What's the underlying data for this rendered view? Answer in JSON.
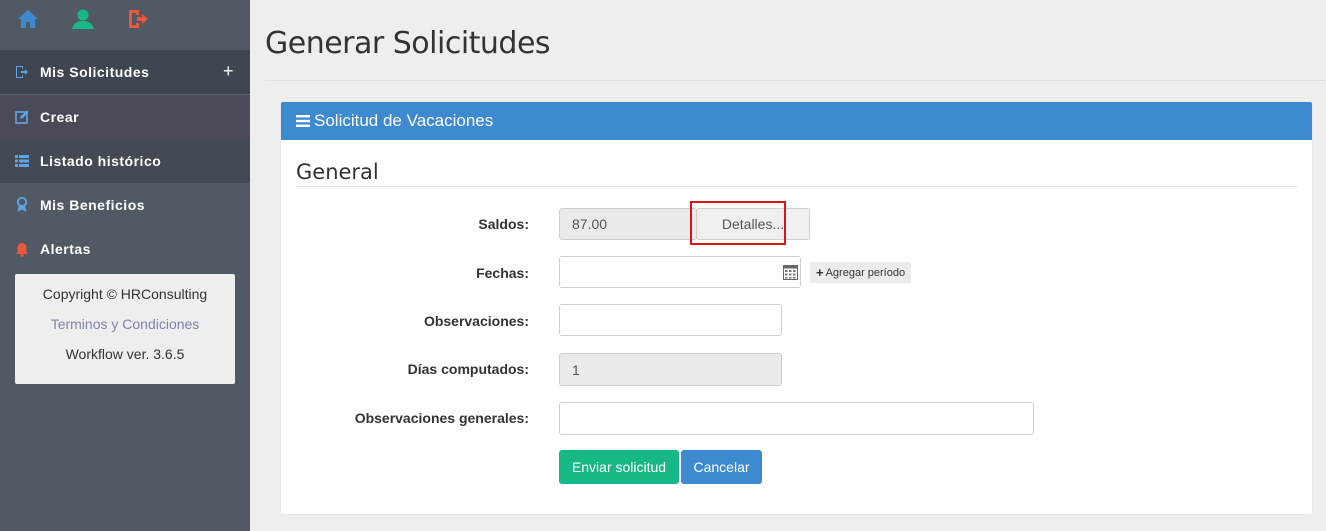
{
  "top_icons": [
    "home-icon",
    "user-icon",
    "logout-icon"
  ],
  "sidebar": {
    "items": [
      {
        "label": "Mis Solicitudes",
        "icon": "request-icon",
        "expand": "+"
      },
      {
        "label": "Crear",
        "icon": "edit-icon"
      },
      {
        "label": "Listado histórico",
        "icon": "list-icon"
      },
      {
        "label": "Mis Beneficios",
        "icon": "award-icon"
      },
      {
        "label": "Alertas",
        "icon": "bell-icon"
      }
    ],
    "footer": {
      "copyright": "Copyright © HRConsulting",
      "terms": "Terminos y Condiciones",
      "version": "Workflow ver. 3.6.5"
    }
  },
  "page": {
    "title": "Generar Solicitudes"
  },
  "panel": {
    "title": "Solicitud de Vacaciones",
    "section": "General",
    "fields": {
      "saldos": {
        "label": "Saldos:",
        "value": "87.00",
        "button": "Detalles..."
      },
      "fechas": {
        "label": "Fechas:",
        "value": "",
        "add_button": "Agregar período"
      },
      "observaciones": {
        "label": "Observaciones:",
        "value": ""
      },
      "dias": {
        "label": "Días computados:",
        "value": "1"
      },
      "obs_generales": {
        "label": "Observaciones generales:",
        "value": ""
      }
    },
    "buttons": {
      "submit": "Enviar solicitud",
      "cancel": "Cancelar"
    }
  },
  "colors": {
    "sidebar": "#515a64",
    "panel_header": "#3d8ad0",
    "submit": "#17b885",
    "highlight": "#d9151b",
    "home_icon": "#3d8ad0",
    "user_icon": "#17b885",
    "logout_icon": "#e9583a"
  }
}
